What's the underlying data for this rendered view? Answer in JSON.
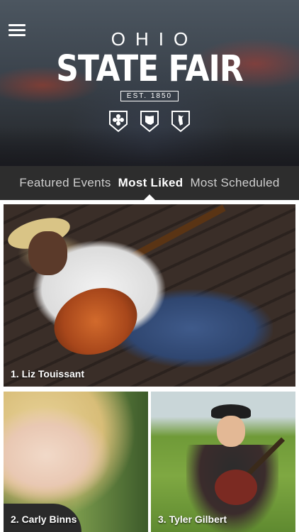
{
  "header": {
    "logo_ohio": "OHIO",
    "logo_title": "STATE FAIR",
    "logo_est": "EST. 1850",
    "badges": [
      "flower-badge-icon",
      "ohio-badge-icon",
      "bird-badge-icon"
    ]
  },
  "tabs": [
    {
      "label": "Featured Events",
      "active": false
    },
    {
      "label": "Most Liked",
      "active": true
    },
    {
      "label": "Most Scheduled",
      "active": false
    }
  ],
  "cards": [
    {
      "caption": "1. Liz Touissant"
    },
    {
      "caption": "2. Carly Binns"
    },
    {
      "caption": "3. Tyler Gilbert"
    }
  ],
  "colors": {
    "tab_bar": "#2d2d2d",
    "active_tab": "#ffffff",
    "inactive_tab": "#cfcfcf"
  }
}
